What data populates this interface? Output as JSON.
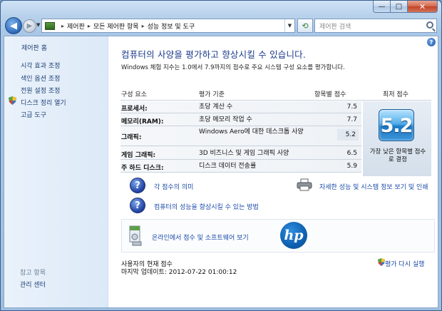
{
  "window": {
    "buttons": {
      "minimize": "—",
      "maximize": "□",
      "close": "✕"
    }
  },
  "nav": {
    "back_glyph": "◀",
    "forward_glyph": "▶",
    "breadcrumbs": [
      "제어판",
      "모든 제어판 항목",
      "성능 정보 및 도구"
    ],
    "search_placeholder": "제어판 검색"
  },
  "sidebar": {
    "home": "제어판 홈",
    "links": [
      "시각 효과 조정",
      "색인 옵션 조정",
      "전원 설정 조정",
      "디스크 정리 열기",
      "고급 도구"
    ],
    "see_also_title": "참고 항목",
    "see_also_links": [
      "관리 센터"
    ]
  },
  "main": {
    "headline": "컴퓨터의 사양을 평가하고 향상시킬 수 있습니다.",
    "subline": "Windows 체험 지수는 1.0에서 7.9까지의 점수로 주요 시스템 구성 요소를 평가합니다.",
    "table": {
      "headers": [
        "구성 요소",
        "평가 기준",
        "항목별 점수",
        "최저 점수"
      ],
      "rows": [
        {
          "component": "프로세서:",
          "criteria": "초당 계산 수",
          "score": "7.5"
        },
        {
          "component": "메모리(RAM):",
          "criteria": "초당 메모리 작업 수",
          "score": "7.7"
        },
        {
          "component": "그래픽:",
          "criteria": "Windows Aero에 대한 데스크톱 사양",
          "score": "5.2"
        },
        {
          "component": "게임 그래픽:",
          "criteria": "3D 비즈니스 및 게임 그래픽 사양",
          "score": "6.5"
        },
        {
          "component": "주 하드 디스크:",
          "criteria": "디스크 데이터 전송률",
          "score": "5.9"
        }
      ],
      "base_score": "5.2",
      "base_caption": "가장 낮은 항목별 점수로 결정"
    },
    "links": {
      "meaning": "각 점수의 의미",
      "improve": "컴퓨터의 성능을 향상시킬 수 있는 방법",
      "details": "자세한 성능 및 시스템 정보 보기 및 인쇄",
      "online": "온라인에서 점수 및 소프트웨어 보기"
    },
    "hp_logo_text": "hp",
    "footer": {
      "current_score_label": "사용자의 현재 점수",
      "last_update": "마지막 업데이트: 2012-07-22 01:00:12",
      "rerun": "평가 다시 실행"
    }
  }
}
